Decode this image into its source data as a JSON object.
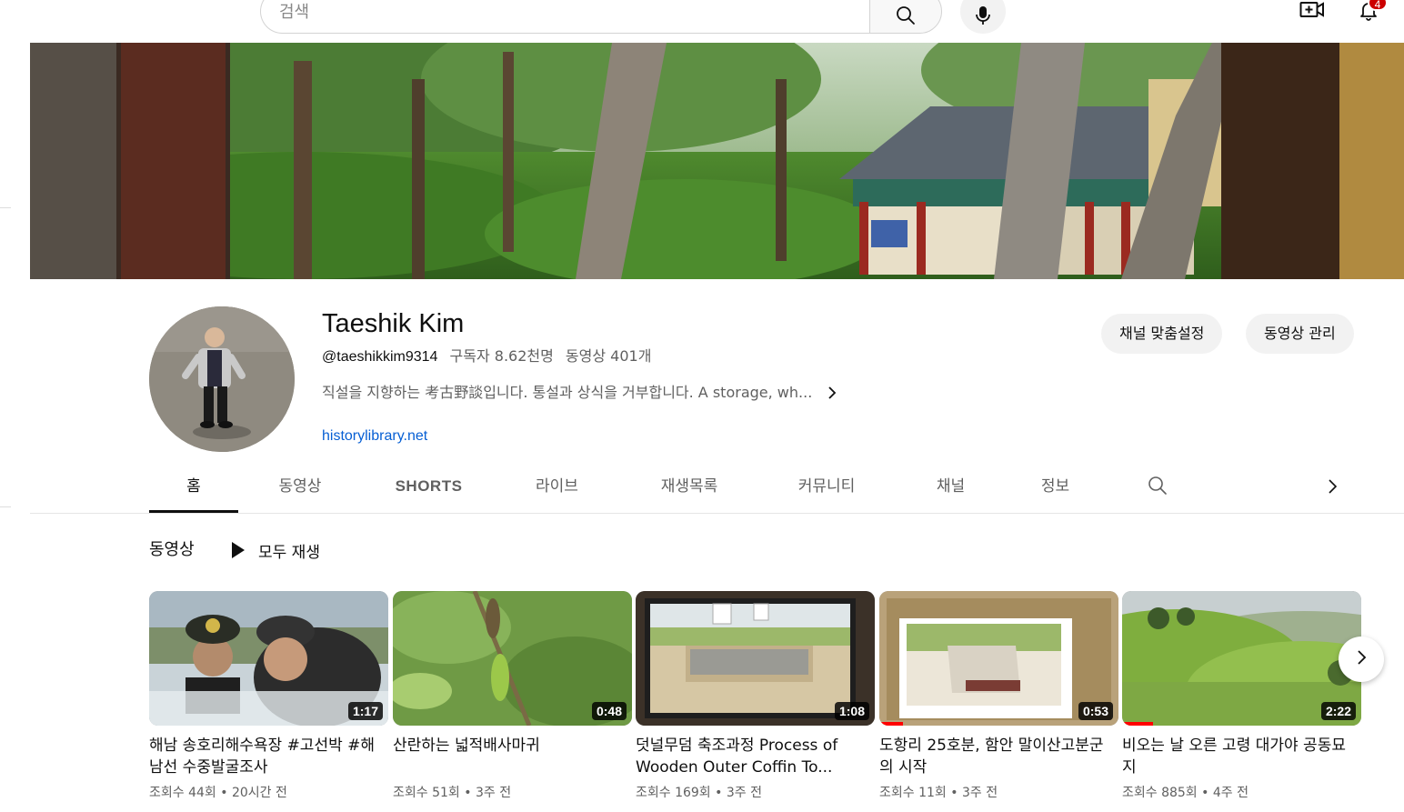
{
  "search": {
    "placeholder": "검색"
  },
  "notifications": {
    "count": "4"
  },
  "channel": {
    "name": "Taeshik Kim",
    "handle": "@taeshikkim9314",
    "subscribers": "구독자 8.62천명",
    "videos": "동영상 401개",
    "description": "직설을 지향하는 考古野談입니다. 통설과 상식을 거부합니다. A storage, wh...",
    "link": "historylibrary.net"
  },
  "actions": {
    "customize": "채널 맞춤설정",
    "manage": "동영상 관리"
  },
  "tabs": [
    {
      "label": "홈"
    },
    {
      "label": "동영상"
    },
    {
      "label": "SHORTS"
    },
    {
      "label": "라이브"
    },
    {
      "label": "재생목록"
    },
    {
      "label": "커뮤니티"
    },
    {
      "label": "채널"
    },
    {
      "label": "정보"
    }
  ],
  "section": {
    "title": "동영상",
    "play_all": "모두 재생"
  },
  "videos": [
    {
      "title": "해남 송호리해수욕장 #고선박 #해남선 수중발굴조사",
      "duration": "1:17",
      "views": "조회수 44회",
      "age": "20시간 전",
      "progress": 0
    },
    {
      "title": "산란하는 넓적배사마귀",
      "duration": "0:48",
      "views": "조회수 51회",
      "age": "3주 전",
      "progress": 0
    },
    {
      "title": "덧널무덤 축조과정 Process of Wooden Outer Coffin To...",
      "duration": "1:08",
      "views": "조회수 169회",
      "age": "3주 전",
      "progress": 0
    },
    {
      "title": "도항리 25호분, 함안 말이산고분군의 시작",
      "duration": "0:53",
      "views": "조회수 11회",
      "age": "3주 전",
      "progress": 0.1
    },
    {
      "title": "비오는 날 오른 고령 대가야 공동묘지",
      "duration": "2:22",
      "views": "조회수 885회",
      "age": "4주 전",
      "progress": 0.13
    }
  ],
  "meta_separator": "•",
  "icons": {
    "search": "search-icon",
    "mic": "mic-icon",
    "create": "video-add-icon",
    "bell": "bell-icon",
    "chevron": "chevron-right-icon",
    "play": "play-icon"
  },
  "colors": {
    "link": "#065fd4",
    "progress": "#ff0000",
    "badge": "#cc0000"
  }
}
